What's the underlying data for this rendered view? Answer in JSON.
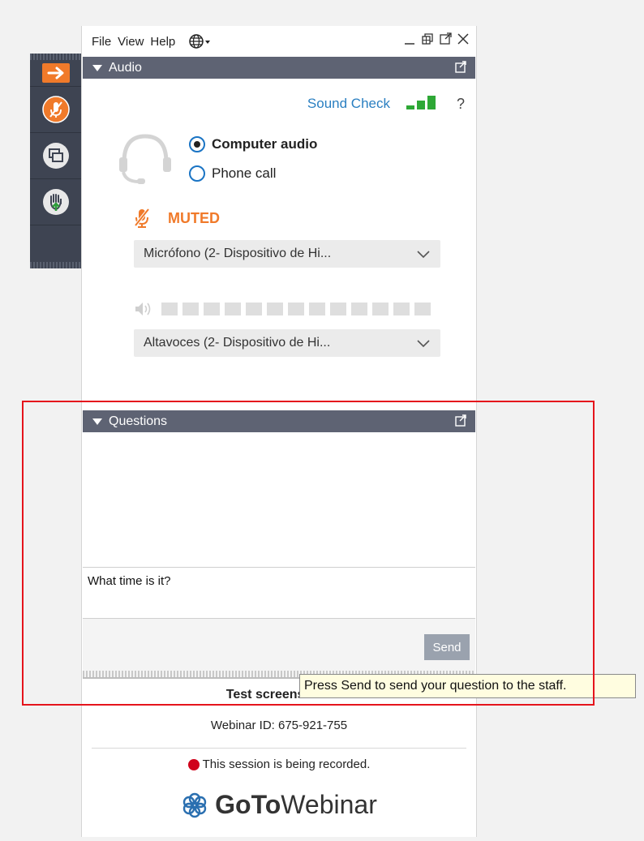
{
  "menubar": {
    "file": "File",
    "view": "View",
    "help": "Help",
    "language_icon": "globe-icon"
  },
  "audio": {
    "section_title": "Audio",
    "sound_check": "Sound Check",
    "help": "?",
    "options": [
      {
        "label": "Computer audio",
        "selected": true
      },
      {
        "label": "Phone call",
        "selected": false
      }
    ],
    "mute_status": "MUTED",
    "microphone": "Micrófono (2- Dispositivo de Hi...",
    "speaker": "Altavoces (2- Dispositivo de Hi..."
  },
  "questions": {
    "section_title": "Questions",
    "input_value": "What time is it?",
    "send_label": "Send"
  },
  "tooltip": "Press Send to send your question to the staff.",
  "session": {
    "title": "Test screenshots",
    "webinar_id": "Webinar ID: 675-921-755",
    "recording": "This session is being recorded."
  },
  "brand": {
    "goto": "GoTo",
    "webinar": "Webinar"
  },
  "colors": {
    "accent_orange": "#f07a2a",
    "link_blue": "#2a7fc1",
    "section_bar": "#5e6373",
    "sidebar": "#3e4452",
    "recording_red": "#d0021b",
    "highlight_red": "#e5141c"
  }
}
